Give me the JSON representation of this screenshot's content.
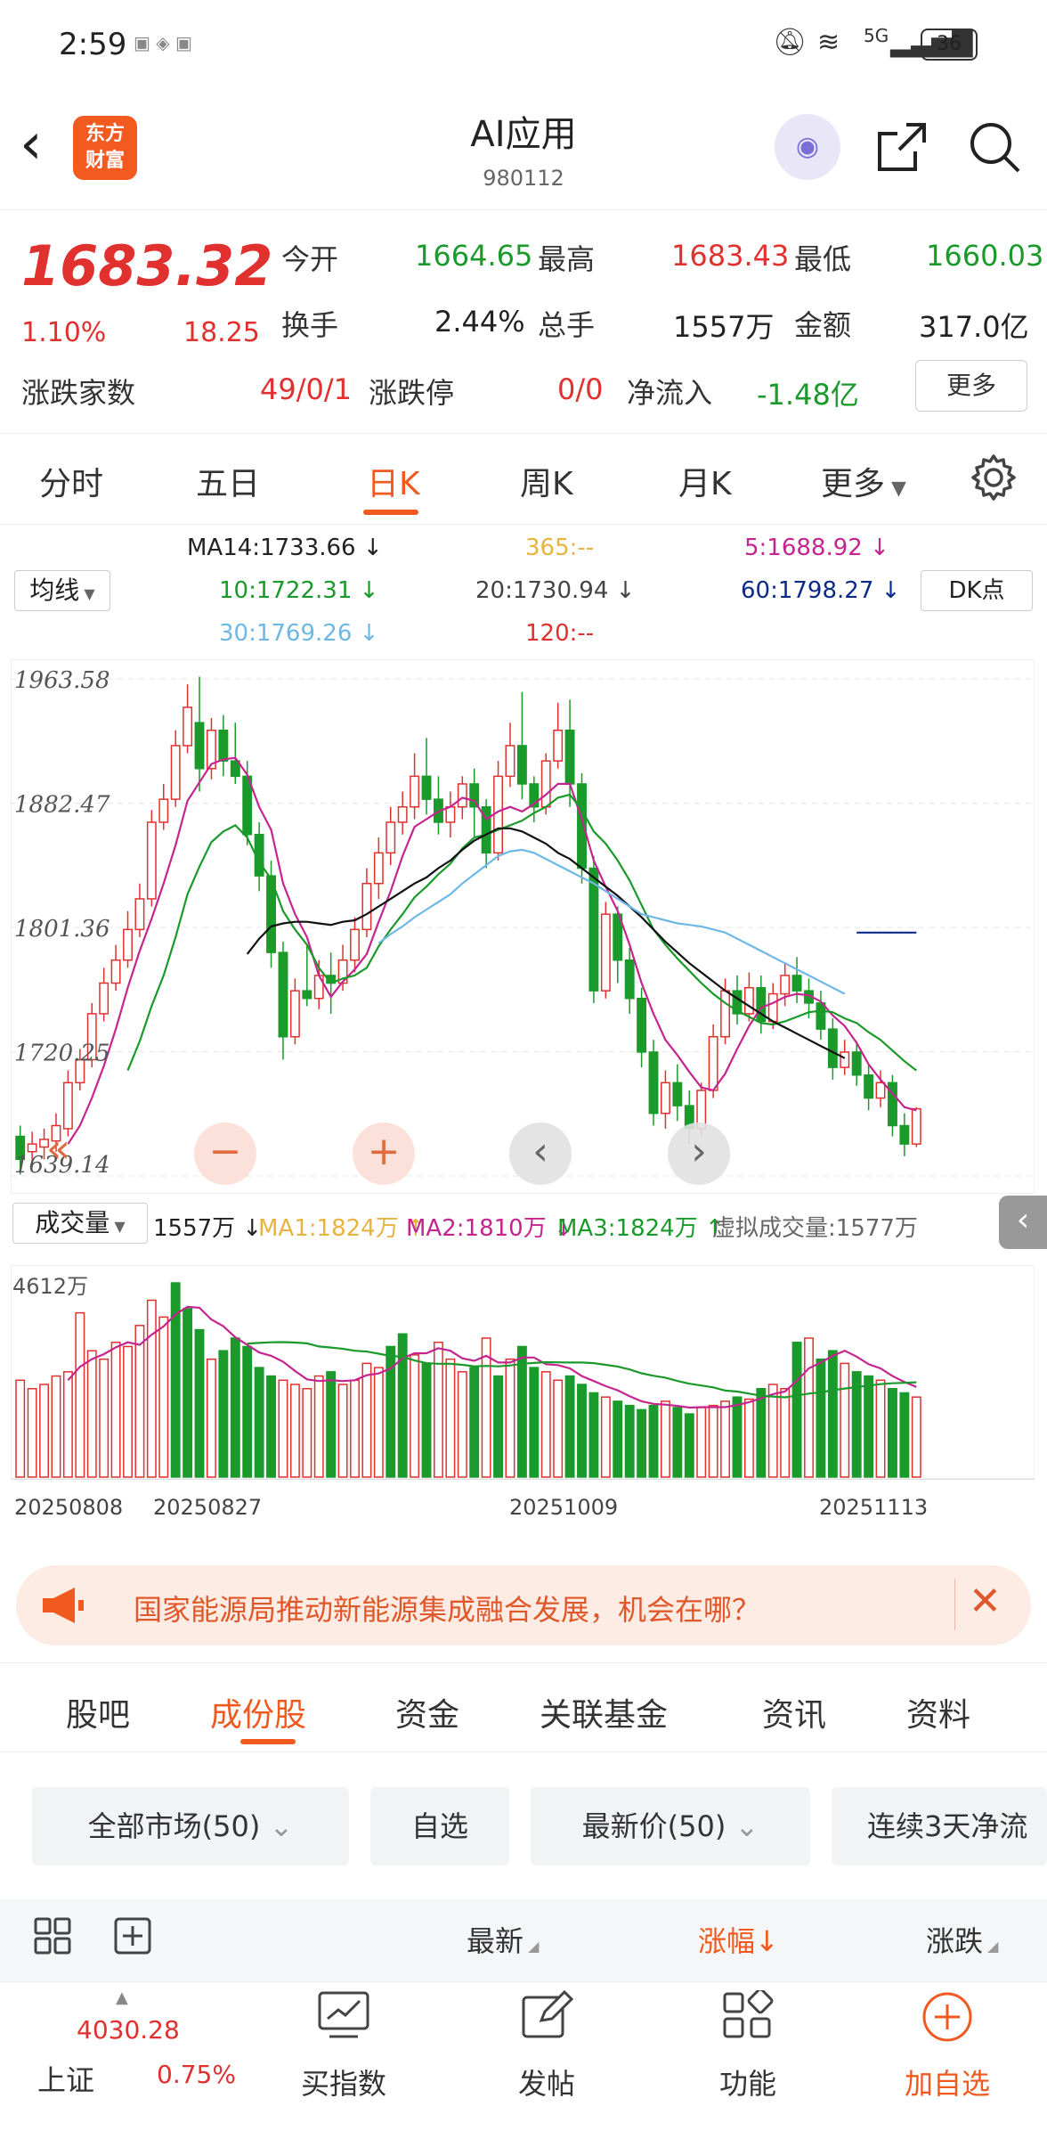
{
  "status_bar": {
    "time": "2:59",
    "battery": "36",
    "network": "5G"
  },
  "header": {
    "logo_line1": "东方",
    "logo_line2": "财富",
    "title": "AI应用",
    "code": "980112"
  },
  "quote": {
    "price": "1683.32",
    "change_pct": "1.10%",
    "change": "18.25",
    "open_label": "今开",
    "open": "1664.65",
    "high_label": "最高",
    "high": "1683.43",
    "low_label": "最低",
    "low": "1660.03",
    "turnover_label": "换手",
    "turnover": "2.44%",
    "volume_label": "总手",
    "volume": "1557万",
    "amount_label": "金额",
    "amount": "317.0亿",
    "breadth_label": "涨跌家数",
    "breadth": "49/0/1",
    "limit_label": "涨跌停",
    "limit": "0/0",
    "netflow_label": "净流入",
    "netflow": "-1.48亿",
    "more_label": "更多"
  },
  "tabs": [
    "分时",
    "五日",
    "日K",
    "周K",
    "月K",
    "更多"
  ],
  "ma_legend": {
    "selector": "均线",
    "ma14": "MA14:1733.66 ↓",
    "ma365": "365:--",
    "ma5": "5:1688.92 ↓",
    "ma10": "10:1722.31 ↓",
    "ma20": "20:1730.94 ↓",
    "ma60": "60:1798.27 ↓",
    "ma30": "30:1769.26 ↓",
    "ma120": "120:--",
    "dk_label": "DK点"
  },
  "chart_data": {
    "type": "candlestick",
    "ylim": [
      1639.14,
      1963.58
    ],
    "y_ticks": [
      "1963.58",
      "1882.47",
      "1801.36",
      "1720.25",
      "1639.14"
    ],
    "x_ticks": [
      "20250808",
      "20250827",
      "20251009",
      "20251113"
    ],
    "candles": [
      [
        1665,
        1650,
        1672,
        1640
      ],
      [
        1655,
        1660,
        1668,
        1645
      ],
      [
        1658,
        1663,
        1670,
        1650
      ],
      [
        1662,
        1672,
        1680,
        1655
      ],
      [
        1670,
        1700,
        1708,
        1665
      ],
      [
        1700,
        1715,
        1722,
        1695
      ],
      [
        1715,
        1745,
        1752,
        1710
      ],
      [
        1745,
        1765,
        1775,
        1740
      ],
      [
        1765,
        1780,
        1790,
        1760
      ],
      [
        1780,
        1800,
        1812,
        1775
      ],
      [
        1800,
        1820,
        1830,
        1795
      ],
      [
        1820,
        1870,
        1878,
        1815
      ],
      [
        1870,
        1885,
        1895,
        1865
      ],
      [
        1885,
        1920,
        1930,
        1880
      ],
      [
        1920,
        1945,
        1960,
        1915
      ],
      [
        1935,
        1905,
        1965,
        1890
      ],
      [
        1905,
        1930,
        1938,
        1898
      ],
      [
        1930,
        1910,
        1940,
        1900
      ],
      [
        1910,
        1900,
        1935,
        1895
      ],
      [
        1900,
        1862,
        1910,
        1855
      ],
      [
        1862,
        1835,
        1870,
        1825
      ],
      [
        1835,
        1785,
        1845,
        1775
      ],
      [
        1785,
        1730,
        1792,
        1715
      ],
      [
        1730,
        1760,
        1768,
        1725
      ],
      [
        1760,
        1755,
        1790,
        1750
      ],
      [
        1755,
        1770,
        1780,
        1748
      ],
      [
        1770,
        1765,
        1785,
        1745
      ],
      [
        1765,
        1780,
        1790,
        1760
      ],
      [
        1780,
        1800,
        1808,
        1772
      ],
      [
        1800,
        1830,
        1840,
        1795
      ],
      [
        1830,
        1850,
        1860,
        1820
      ],
      [
        1850,
        1870,
        1880,
        1842
      ],
      [
        1870,
        1880,
        1890,
        1862
      ],
      [
        1880,
        1900,
        1915,
        1872
      ],
      [
        1900,
        1885,
        1925,
        1875
      ],
      [
        1885,
        1870,
        1900,
        1862
      ],
      [
        1870,
        1880,
        1890,
        1860
      ],
      [
        1880,
        1895,
        1900,
        1872
      ],
      [
        1895,
        1880,
        1905,
        1860
      ],
      [
        1880,
        1850,
        1885,
        1840
      ],
      [
        1850,
        1900,
        1910,
        1845
      ],
      [
        1900,
        1920,
        1935,
        1893
      ],
      [
        1920,
        1895,
        1955,
        1885
      ],
      [
        1895,
        1880,
        1900,
        1870
      ],
      [
        1880,
        1910,
        1915,
        1875
      ],
      [
        1910,
        1930,
        1948,
        1905
      ],
      [
        1930,
        1895,
        1950,
        1880
      ],
      [
        1895,
        1840,
        1902,
        1830
      ],
      [
        1840,
        1760,
        1848,
        1752
      ],
      [
        1760,
        1810,
        1818,
        1755
      ],
      [
        1810,
        1780,
        1815,
        1765
      ],
      [
        1780,
        1755,
        1788,
        1745
      ],
      [
        1755,
        1720,
        1762,
        1710
      ],
      [
        1720,
        1680,
        1728,
        1672
      ],
      [
        1680,
        1700,
        1708,
        1670
      ],
      [
        1700,
        1685,
        1712,
        1675
      ],
      [
        1685,
        1670,
        1695,
        1660
      ],
      [
        1670,
        1695,
        1700,
        1665
      ],
      [
        1695,
        1730,
        1738,
        1690
      ],
      [
        1730,
        1760,
        1768,
        1725
      ],
      [
        1760,
        1745,
        1770,
        1738
      ],
      [
        1745,
        1762,
        1772,
        1740
      ],
      [
        1762,
        1740,
        1770,
        1732
      ],
      [
        1740,
        1758,
        1765,
        1735
      ],
      [
        1758,
        1770,
        1778,
        1750
      ],
      [
        1770,
        1760,
        1782,
        1752
      ],
      [
        1760,
        1752,
        1768,
        1742
      ],
      [
        1752,
        1735,
        1760,
        1728
      ],
      [
        1735,
        1710,
        1742,
        1702
      ],
      [
        1710,
        1720,
        1728,
        1705
      ],
      [
        1720,
        1705,
        1727,
        1698
      ],
      [
        1705,
        1690,
        1712,
        1682
      ],
      [
        1690,
        1700,
        1708,
        1684
      ],
      [
        1700,
        1672,
        1705,
        1665
      ],
      [
        1672,
        1660,
        1680,
        1652
      ],
      [
        1660,
        1683,
        1684,
        1658
      ]
    ],
    "ma_lines": [
      {
        "name": "MA5",
        "color": "#c5258e",
        "values": [
          null,
          null,
          null,
          null,
          1660,
          1672,
          1690,
          1711,
          1735,
          1762,
          1786,
          1807,
          1830,
          1855,
          1884,
          1896,
          1908,
          1911,
          1912,
          1901,
          1880,
          1865,
          1830,
          1810,
          1795,
          1770,
          1756,
          1766,
          1774,
          1784,
          1805,
          1825,
          1848,
          1867,
          1872,
          1877,
          1880,
          1886,
          1884,
          1872,
          1877,
          1880,
          1877,
          1882,
          1888,
          1895,
          1895,
          1872,
          1845,
          1828,
          1812,
          1790,
          1765,
          1745,
          1728,
          1718,
          1707,
          1697,
          1695,
          1706,
          1722,
          1737,
          1749,
          1752,
          1756,
          1758,
          1757,
          1753,
          1744,
          1737,
          1726,
          1712,
          1702,
          1693,
          1684,
          1682
        ]
      },
      {
        "name": "MA10",
        "color": "#1a9a2a",
        "values": [
          null,
          null,
          null,
          null,
          null,
          null,
          null,
          null,
          null,
          1708,
          1727,
          1750,
          1770,
          1795,
          1823,
          1841,
          1857,
          1864,
          1868,
          1860,
          1844,
          1833,
          1812,
          1800,
          1790,
          1775,
          1765,
          1768,
          1770,
          1775,
          1789,
          1800,
          1810,
          1821,
          1828,
          1836,
          1843,
          1853,
          1860,
          1862,
          1865,
          1868,
          1871,
          1876,
          1880,
          1886,
          1888,
          1878,
          1864,
          1856,
          1845,
          1832,
          1816,
          1800,
          1790,
          1781,
          1773,
          1765,
          1758,
          1752,
          1747,
          1743,
          1739,
          1738,
          1740,
          1743,
          1746,
          1747,
          1746,
          1742,
          1739,
          1733,
          1728,
          1721,
          1714,
          1708
        ]
      },
      {
        "name": "MA20",
        "color": "#111111",
        "values": [
          null,
          null,
          null,
          null,
          null,
          null,
          null,
          null,
          null,
          null,
          null,
          null,
          null,
          null,
          null,
          null,
          null,
          null,
          null,
          1784,
          1794,
          1802,
          1804,
          1805,
          1805,
          1804,
          1803,
          1805,
          1806,
          1810,
          1815,
          1820,
          1825,
          1830,
          1834,
          1840,
          1845,
          1852,
          1858,
          1862,
          1866,
          1866,
          1864,
          1860,
          1856,
          1850,
          1846,
          1840,
          1834,
          1828,
          1822,
          1815,
          1808,
          1800,
          1792,
          1785,
          1778,
          1772,
          1766,
          1760,
          1755,
          1750,
          1745,
          1740,
          1736,
          1732,
          1728,
          1724,
          1720,
          1716
        ]
      },
      {
        "name": "MA30",
        "color": "#6eb8e6",
        "values": [
          null,
          null,
          null,
          null,
          null,
          null,
          null,
          null,
          null,
          null,
          null,
          null,
          null,
          null,
          null,
          null,
          null,
          null,
          null,
          null,
          null,
          null,
          null,
          null,
          null,
          null,
          null,
          null,
          null,
          null,
          1791,
          1797,
          1802,
          1808,
          1813,
          1818,
          1823,
          1830,
          1836,
          1842,
          1848,
          1851,
          1852,
          1850,
          1846,
          1842,
          1838,
          1834,
          1830,
          1825,
          1820,
          1815,
          1810,
          1808,
          1806,
          1804,
          1803,
          1802,
          1800,
          1798,
          1794,
          1790,
          1786,
          1782,
          1778,
          1774,
          1770,
          1766,
          1762,
          1758
        ]
      },
      {
        "name": "MA60",
        "color": "#0c2a8a",
        "values": [
          null,
          null,
          null,
          null,
          null,
          null,
          null,
          null,
          null,
          null,
          null,
          null,
          null,
          null,
          null,
          null,
          null,
          null,
          null,
          null,
          null,
          null,
          null,
          null,
          null,
          null,
          null,
          null,
          null,
          null,
          null,
          null,
          null,
          null,
          null,
          null,
          null,
          null,
          null,
          null,
          null,
          null,
          null,
          null,
          null,
          null,
          null,
          null,
          null,
          null,
          null,
          null,
          null,
          null,
          null,
          null,
          null,
          null,
          null,
          null,
          null,
          null,
          null,
          null,
          null,
          null,
          null,
          null,
          null,
          null,
          1798,
          1798,
          1798,
          1798,
          1798,
          1798
        ]
      }
    ],
    "volume": {
      "label": "成交量",
      "current": "1557万 ↓",
      "ma1": "MA1:1824万 ↑",
      "ma2": "MA2:1810万 ↓",
      "ma3": "MA3:1824万 ↑",
      "virtual": "虚拟成交量:1577万",
      "max_label": "4612万",
      "ylim": [
        0,
        4612
      ],
      "values": [
        2300,
        2100,
        2200,
        2400,
        2500,
        3900,
        3000,
        2800,
        3200,
        3100,
        3600,
        4200,
        3800,
        4612,
        4000,
        3500,
        2800,
        3000,
        3300,
        3100,
        2600,
        2400,
        2300,
        2200,
        2100,
        2400,
        2500,
        2200,
        2300,
        2700,
        2600,
        3100,
        3400,
        2900,
        2700,
        3200,
        2800,
        2500,
        2600,
        3300,
        2400,
        2800,
        3100,
        2600,
        2500,
        2300,
        2400,
        2200,
        2000,
        1900,
        1800,
        1700,
        1600,
        1700,
        1800,
        1650,
        1500,
        1650,
        1700,
        1800,
        1900,
        1850,
        2100,
        2200,
        2100,
        3200,
        3300,
        2800,
        3000,
        2700,
        2500,
        2400,
        2300,
        2100,
        2000,
        1900
      ],
      "up": [
        true,
        true,
        true,
        true,
        true,
        true,
        true,
        true,
        true,
        true,
        true,
        true,
        true,
        false,
        false,
        false,
        true,
        false,
        false,
        false,
        false,
        false,
        true,
        true,
        true,
        true,
        false,
        true,
        true,
        true,
        true,
        false,
        false,
        true,
        false,
        true,
        true,
        true,
        false,
        true,
        false,
        true,
        false,
        false,
        true,
        true,
        false,
        false,
        false,
        true,
        false,
        false,
        false,
        false,
        true,
        false,
        false,
        true,
        true,
        true,
        false,
        true,
        false,
        true,
        true,
        false,
        true,
        false,
        false,
        true,
        false,
        false,
        true,
        false,
        false,
        true
      ]
    }
  },
  "chart_buttons": {
    "zoom_out": "−",
    "zoom_in": "+",
    "prev": "‹",
    "next": "›",
    "rewind": "«"
  },
  "banner": {
    "text": "国家能源局推动新能源集成融合发展，机会在哪？"
  },
  "sub_tabs": [
    "股吧",
    "成份股",
    "资金",
    "关联基金",
    "资讯",
    "资料"
  ],
  "filters": [
    "全部市场(50)",
    "自选",
    "最新价(50)",
    "连续3天净流"
  ],
  "sort_headers": {
    "latest": "最新",
    "change_pct": "涨幅↓",
    "change": "涨跌"
  },
  "bottom_nav": {
    "index_value": "4030.28",
    "index_name": "上证",
    "index_pct": "0.75%",
    "buy_index": "买指数",
    "post": "发帖",
    "functions": "功能",
    "add_watch": "加自选"
  },
  "colors": {
    "up": "#e0312f",
    "down": "#1a9a2a",
    "accent": "#f05a1f"
  }
}
